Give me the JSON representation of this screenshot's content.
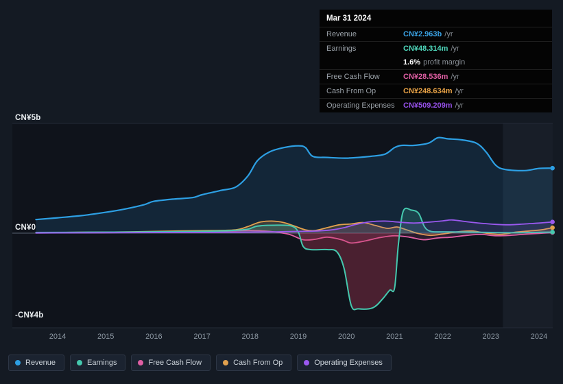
{
  "tooltip": {
    "title": "Mar 31 2024",
    "rows": [
      {
        "label": "Revenue",
        "value": "CN¥2.963b",
        "suffix": "/yr",
        "color": "#3aa2e4",
        "sep": false
      },
      {
        "label": "Earnings",
        "value": "CN¥48.314m",
        "suffix": "/yr",
        "color": "#4fd8bc",
        "sep": true
      },
      {
        "label": "",
        "value": "1.6%",
        "suffix": "profit margin",
        "color": "#ffffff",
        "sep": false
      },
      {
        "label": "Free Cash Flow",
        "value": "CN¥28.536m",
        "suffix": "/yr",
        "color": "#e05fa4",
        "sep": true
      },
      {
        "label": "Cash From Op",
        "value": "CN¥248.634m",
        "suffix": "/yr",
        "color": "#eba447",
        "sep": true
      },
      {
        "label": "Operating Expenses",
        "value": "CN¥509.209m",
        "suffix": "/yr",
        "color": "#9550e8",
        "sep": true
      }
    ]
  },
  "legend": {
    "items": [
      {
        "label": "Revenue",
        "color": "#2d9fe3"
      },
      {
        "label": "Earnings",
        "color": "#45c8ae"
      },
      {
        "label": "Free Cash Flow",
        "color": "#e05fa4"
      },
      {
        "label": "Cash From Op",
        "color": "#e2a14e"
      },
      {
        "label": "Operating Expenses",
        "color": "#9b59f0"
      }
    ]
  },
  "chart_data": {
    "type": "area",
    "title": "Company financial history and analyst view, CN¥ billions per year",
    "units": "CN¥ billions /yr",
    "x_range": [
      2013.55,
      2024.28
    ],
    "y_range": [
      -4.3,
      5.0
    ],
    "x_ticks": [
      2014,
      2015,
      2016,
      2017,
      2018,
      2019,
      2020,
      2021,
      2022,
      2023,
      2024
    ],
    "y_ticks": [
      {
        "label": "CN¥5b",
        "value": 5
      },
      {
        "label": "CN¥0",
        "value": 0
      },
      {
        "label": "-CN¥4b",
        "value": -4
      }
    ],
    "grid": true,
    "legend_position": "bottom",
    "forecast_band_start": 2023.25,
    "series": [
      {
        "name": "Revenue",
        "color": "#2d9fe3",
        "fill": "rgba(45,140,210,0.16)",
        "stroke_width": 2.2,
        "points": [
          [
            2013.55,
            0.62
          ],
          [
            2014,
            0.7
          ],
          [
            2014.5,
            0.8
          ],
          [
            2015,
            0.95
          ],
          [
            2015.4,
            1.1
          ],
          [
            2015.8,
            1.3
          ],
          [
            2016,
            1.45
          ],
          [
            2016.4,
            1.55
          ],
          [
            2016.8,
            1.62
          ],
          [
            2017,
            1.75
          ],
          [
            2017.4,
            1.95
          ],
          [
            2017.7,
            2.1
          ],
          [
            2017.95,
            2.6
          ],
          [
            2018.15,
            3.3
          ],
          [
            2018.4,
            3.7
          ],
          [
            2018.7,
            3.9
          ],
          [
            2019,
            3.98
          ],
          [
            2019.15,
            3.9
          ],
          [
            2019.3,
            3.5
          ],
          [
            2019.6,
            3.45
          ],
          [
            2020,
            3.42
          ],
          [
            2020.5,
            3.5
          ],
          [
            2020.8,
            3.6
          ],
          [
            2021,
            3.9
          ],
          [
            2021.15,
            4.0
          ],
          [
            2021.4,
            4.0
          ],
          [
            2021.7,
            4.1
          ],
          [
            2021.9,
            4.35
          ],
          [
            2022.1,
            4.3
          ],
          [
            2022.4,
            4.25
          ],
          [
            2022.7,
            4.1
          ],
          [
            2022.9,
            3.7
          ],
          [
            2023.1,
            3.1
          ],
          [
            2023.3,
            2.9
          ],
          [
            2023.7,
            2.85
          ],
          [
            2024,
            2.95
          ],
          [
            2024.28,
            2.963
          ]
        ]
      },
      {
        "name": "Cash From Op",
        "color": "#e2a14e",
        "fill": "rgba(226,161,78,0.20)",
        "stroke_width": 1.8,
        "points": [
          [
            2013.55,
            0.02
          ],
          [
            2014.5,
            0.04
          ],
          [
            2015.5,
            0.06
          ],
          [
            2016.5,
            0.1
          ],
          [
            2017.2,
            0.12
          ],
          [
            2017.7,
            0.15
          ],
          [
            2017.95,
            0.3
          ],
          [
            2018.2,
            0.5
          ],
          [
            2018.45,
            0.55
          ],
          [
            2018.7,
            0.48
          ],
          [
            2018.95,
            0.3
          ],
          [
            2019.15,
            0.15
          ],
          [
            2019.35,
            0.12
          ],
          [
            2019.6,
            0.25
          ],
          [
            2019.85,
            0.38
          ],
          [
            2020.1,
            0.42
          ],
          [
            2020.35,
            0.48
          ],
          [
            2020.6,
            0.35
          ],
          [
            2020.85,
            0.22
          ],
          [
            2021.05,
            0.28
          ],
          [
            2021.25,
            0.15
          ],
          [
            2021.5,
            -0.02
          ],
          [
            2021.75,
            -0.1
          ],
          [
            2022,
            -0.04
          ],
          [
            2022.3,
            0.06
          ],
          [
            2022.6,
            0.1
          ],
          [
            2022.9,
            0.0
          ],
          [
            2023.2,
            -0.06
          ],
          [
            2023.5,
            0.04
          ],
          [
            2023.8,
            0.1
          ],
          [
            2024.05,
            0.15
          ],
          [
            2024.28,
            0.249
          ]
        ]
      },
      {
        "name": "Free Cash Flow",
        "color": "#e05fa4",
        "fill": "rgba(224,95,164,0.14)",
        "stroke_width": 1.8,
        "points": [
          [
            2013.55,
            0.01
          ],
          [
            2014.5,
            0.02
          ],
          [
            2015.5,
            0.03
          ],
          [
            2016.3,
            0.06
          ],
          [
            2017,
            0.05
          ],
          [
            2017.6,
            0.1
          ],
          [
            2018,
            0.12
          ],
          [
            2018.4,
            0.08
          ],
          [
            2018.8,
            -0.05
          ],
          [
            2019.1,
            -0.3
          ],
          [
            2019.35,
            -0.28
          ],
          [
            2019.6,
            -0.18
          ],
          [
            2019.9,
            -0.3
          ],
          [
            2020.1,
            -0.45
          ],
          [
            2020.4,
            -0.35
          ],
          [
            2020.7,
            -0.2
          ],
          [
            2021,
            -0.12
          ],
          [
            2021.3,
            -0.18
          ],
          [
            2021.6,
            -0.3
          ],
          [
            2021.9,
            -0.22
          ],
          [
            2022.2,
            -0.18
          ],
          [
            2022.5,
            -0.1
          ],
          [
            2022.8,
            -0.06
          ],
          [
            2023.1,
            -0.12
          ],
          [
            2023.4,
            -0.1
          ],
          [
            2023.7,
            -0.05
          ],
          [
            2024,
            -0.01
          ],
          [
            2024.28,
            0.029
          ]
        ]
      },
      {
        "name": "Earnings",
        "color": "#45c8ae",
        "fill_pos": "rgba(69,200,174,0.18)",
        "fill_neg": "rgba(199,62,92,0.32)",
        "stroke_width": 2,
        "points": [
          [
            2013.55,
            0.03
          ],
          [
            2014.5,
            0.04
          ],
          [
            2015.5,
            0.05
          ],
          [
            2016.5,
            0.07
          ],
          [
            2017,
            0.08
          ],
          [
            2017.6,
            0.12
          ],
          [
            2017.95,
            0.18
          ],
          [
            2018.15,
            0.32
          ],
          [
            2018.5,
            0.36
          ],
          [
            2018.85,
            0.33
          ],
          [
            2019.0,
            0.05
          ],
          [
            2019.1,
            -0.6
          ],
          [
            2019.25,
            -0.75
          ],
          [
            2019.6,
            -0.75
          ],
          [
            2019.8,
            -0.85
          ],
          [
            2019.95,
            -1.6
          ],
          [
            2020.1,
            -3.3
          ],
          [
            2020.25,
            -3.45
          ],
          [
            2020.55,
            -3.4
          ],
          [
            2020.75,
            -3.0
          ],
          [
            2020.9,
            -2.6
          ],
          [
            2021.0,
            -2.5
          ],
          [
            2021.08,
            -0.5
          ],
          [
            2021.18,
            1.0
          ],
          [
            2021.35,
            1.05
          ],
          [
            2021.5,
            0.9
          ],
          [
            2021.62,
            0.3
          ],
          [
            2021.75,
            0.08
          ],
          [
            2022,
            0.06
          ],
          [
            2022.5,
            0.05
          ],
          [
            2023,
            0.03
          ],
          [
            2023.5,
            0.02
          ],
          [
            2024,
            0.04
          ],
          [
            2024.28,
            0.048
          ]
        ]
      },
      {
        "name": "Operating Expenses",
        "color": "#9b59f0",
        "fill": "rgba(155,89,240,0.12)",
        "stroke_width": 1.8,
        "points": [
          [
            2013.55,
            0.01
          ],
          [
            2015,
            0.02
          ],
          [
            2016.5,
            0.03
          ],
          [
            2017.5,
            0.04
          ],
          [
            2018.5,
            0.06
          ],
          [
            2019,
            0.08
          ],
          [
            2019.4,
            0.1
          ],
          [
            2019.7,
            0.15
          ],
          [
            2019.95,
            0.25
          ],
          [
            2020.2,
            0.4
          ],
          [
            2020.5,
            0.52
          ],
          [
            2020.8,
            0.55
          ],
          [
            2021.1,
            0.5
          ],
          [
            2021.4,
            0.46
          ],
          [
            2021.7,
            0.5
          ],
          [
            2022,
            0.56
          ],
          [
            2022.2,
            0.6
          ],
          [
            2022.5,
            0.52
          ],
          [
            2022.8,
            0.45
          ],
          [
            2023.1,
            0.4
          ],
          [
            2023.4,
            0.38
          ],
          [
            2023.7,
            0.42
          ],
          [
            2024,
            0.46
          ],
          [
            2024.28,
            0.509
          ]
        ]
      }
    ]
  }
}
